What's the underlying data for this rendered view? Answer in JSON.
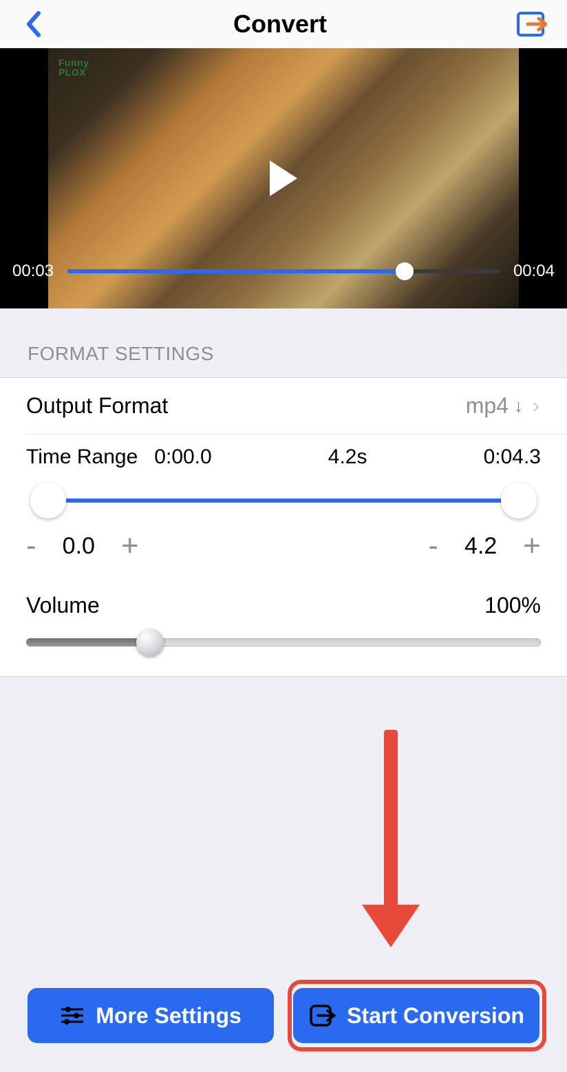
{
  "header": {
    "title": "Convert"
  },
  "video": {
    "watermark_line1": "Funny",
    "watermark_line2": "PLOX",
    "current_time": "00:03",
    "total_time": "00:04",
    "progress_pct": 78
  },
  "format_section": {
    "heading": "FORMAT SETTINGS"
  },
  "output": {
    "label": "Output Format",
    "value": "mp4",
    "download_glyph": "↓"
  },
  "time_range": {
    "label": "Time Range",
    "start": "0:00.0",
    "duration": "4.2s",
    "end": "0:04.3",
    "adjust_left_value": "0.0",
    "adjust_right_value": "4.2",
    "minus": "-",
    "plus": "+"
  },
  "volume": {
    "label": "Volume",
    "value": "100%",
    "slider_pct": 24
  },
  "buttons": {
    "more": "More Settings",
    "start": "Start Conversion"
  }
}
